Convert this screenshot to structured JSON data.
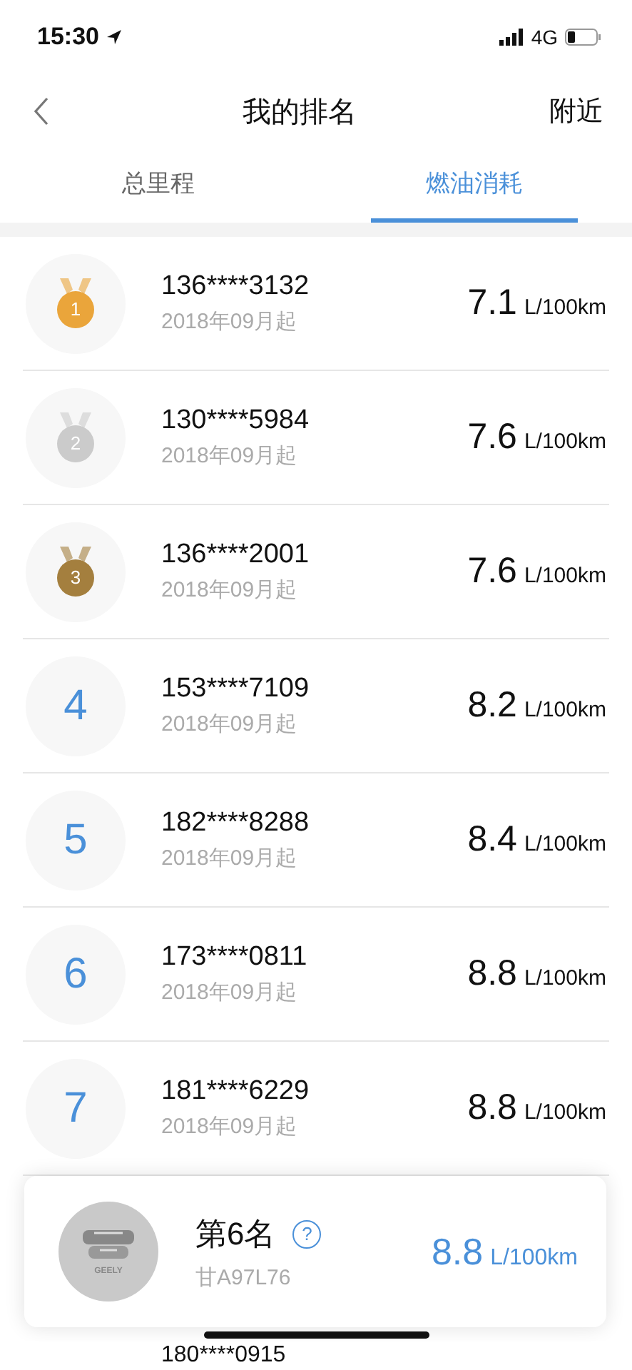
{
  "status_bar": {
    "time": "15:30",
    "network": "4G"
  },
  "nav": {
    "title": "我的排名",
    "action": "附近"
  },
  "tabs": [
    {
      "label": "总里程",
      "selected": false
    },
    {
      "label": "燃油消耗",
      "selected": true
    }
  ],
  "rankings": [
    {
      "kind": "medal",
      "rank": "1",
      "color": "#eaa53b",
      "name": "136****3132",
      "since": "2018年09月起",
      "value": "7.1",
      "unit": "L/100km"
    },
    {
      "kind": "medal",
      "rank": "2",
      "color": "#cbcbcb",
      "name": "130****5984",
      "since": "2018年09月起",
      "value": "7.6",
      "unit": "L/100km"
    },
    {
      "kind": "medal",
      "rank": "3",
      "color": "#a47f3e",
      "name": "136****2001",
      "since": "2018年09月起",
      "value": "7.6",
      "unit": "L/100km"
    },
    {
      "kind": "number",
      "rank": "4",
      "name": "153****7109",
      "since": "2018年09月起",
      "value": "8.2",
      "unit": "L/100km"
    },
    {
      "kind": "number",
      "rank": "5",
      "name": "182****8288",
      "since": "2018年09月起",
      "value": "8.4",
      "unit": "L/100km"
    },
    {
      "kind": "number",
      "rank": "6",
      "name": "173****0811",
      "since": "2018年09月起",
      "value": "8.8",
      "unit": "L/100km"
    },
    {
      "kind": "number",
      "rank": "7",
      "name": "181****6229",
      "since": "2018年09月起",
      "value": "8.8",
      "unit": "L/100km"
    }
  ],
  "partial_row": {
    "name": "180****0915"
  },
  "my_rank": {
    "logo_text": "GEELY",
    "rank": "第6名",
    "help": "?",
    "plate": "甘A97L76",
    "value": "8.8",
    "unit": "L/100km"
  }
}
